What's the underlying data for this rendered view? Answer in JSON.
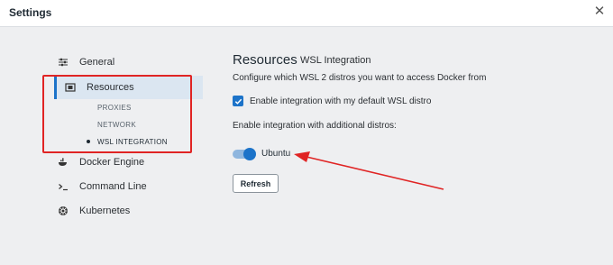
{
  "window": {
    "title": "Settings"
  },
  "sidebar": {
    "items": [
      {
        "label": "General",
        "icon": "sliders-icon"
      },
      {
        "label": "Resources",
        "icon": "chip-icon"
      },
      {
        "label": "Docker Engine",
        "icon": "whale-icon"
      },
      {
        "label": "Command Line",
        "icon": "terminal-icon"
      },
      {
        "label": "Kubernetes",
        "icon": "helm-icon"
      }
    ],
    "resources_sub": [
      "PROXIES",
      "NETWORK",
      "WSL INTEGRATION"
    ]
  },
  "main": {
    "title": "Resources",
    "subtitle": "WSL Integration",
    "description": "Configure which WSL 2 distros you want to access Docker from",
    "default_distro_checkbox": {
      "label": "Enable integration with my default WSL distro",
      "checked": true
    },
    "additional_label": "Enable integration with additional distros:",
    "distro_toggle": {
      "label": "Ubuntu",
      "on": true
    },
    "refresh_label": "Refresh"
  },
  "annotation": {
    "color": "#e02424"
  },
  "colors": {
    "accent": "#1c73c9",
    "background": "#eeeff1"
  }
}
